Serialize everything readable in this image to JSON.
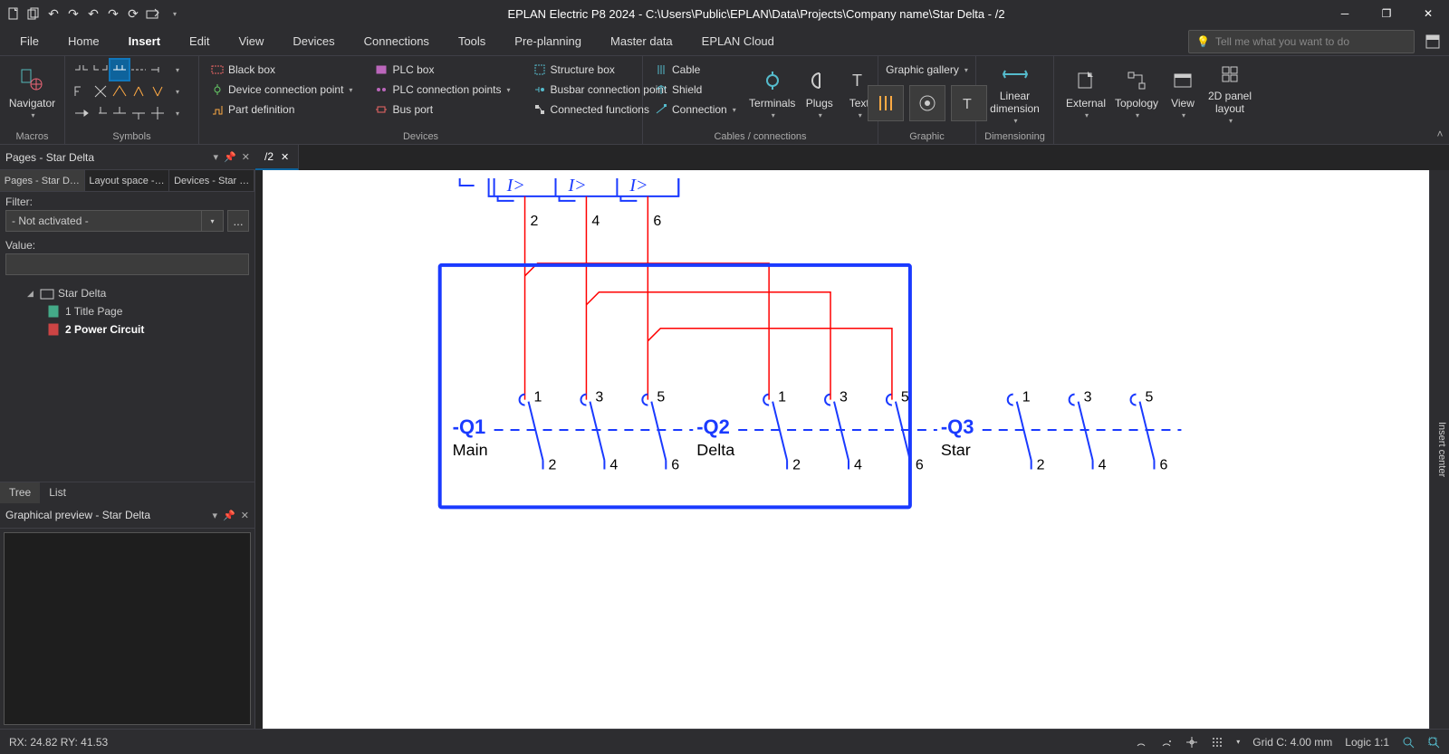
{
  "titlebar": {
    "app_title": "EPLAN Electric P8 2024 - C:\\Users\\Public\\EPLAN\\Data\\Projects\\Company name\\Star Delta - /2"
  },
  "menu": {
    "items": [
      "File",
      "Home",
      "Insert",
      "Edit",
      "View",
      "Devices",
      "Connections",
      "Tools",
      "Pre-planning",
      "Master data",
      "EPLAN Cloud"
    ],
    "active": "Insert",
    "search_placeholder": "Tell me what you want to do"
  },
  "ribbon": {
    "macros": {
      "navigator": "Navigator",
      "label": "Macros"
    },
    "symbols": {
      "label": "Symbols"
    },
    "devices": {
      "label": "Devices",
      "black_box": "Black box",
      "device_conn": "Device connection point",
      "part_def": "Part definition",
      "plc_box": "PLC box",
      "plc_conn": "PLC connection points",
      "bus_port": "Bus port",
      "structure_box": "Structure box",
      "busbar_conn": "Busbar connection point",
      "connected_fn": "Connected functions"
    },
    "cables": {
      "label": "Cables / connections",
      "cable": "Cable",
      "shield": "Shield",
      "connection": "Connection",
      "terminals": "Terminals",
      "plugs": "Plugs",
      "text": "Text"
    },
    "graphic": {
      "label": "Graphic",
      "gallery": "Graphic gallery"
    },
    "dimensioning": {
      "label": "Dimensioning",
      "linear": "Linear dimension"
    },
    "external": "External",
    "topology": "Topology",
    "view": "View",
    "panel2d": "2D panel layout"
  },
  "doc_tabs": {
    "tab1": "/2"
  },
  "left": {
    "header": "Pages - Star Delta",
    "sub1": "Pages - Star D…",
    "sub2": "Layout space -…",
    "sub3": "Devices - Star …",
    "filter_label": "Filter:",
    "filter_value": "- Not activated -",
    "filter_btn": "...",
    "value_label": "Value:",
    "tree_root": "Star Delta",
    "tree_p1": "1 Title Page",
    "tree_p2": "2 Power Circuit",
    "tree_tab_tree": "Tree",
    "tree_tab_list": "List",
    "preview_header": "Graphical preview - Star Delta"
  },
  "right_tab": "Insert center",
  "status": {
    "coords": "RX: 24.82 RY: 41.53",
    "grid": "Grid C: 4.00 mm",
    "logic": "Logic 1:1"
  },
  "schematic": {
    "ol_labels": [
      "I>",
      "I>",
      "I>"
    ],
    "ol_terminals": [
      "2",
      "4",
      "6"
    ],
    "contactors": [
      {
        "tag": "-Q1",
        "name": "Main",
        "top": [
          "1",
          "3",
          "5"
        ],
        "bot": [
          "2",
          "4",
          "6"
        ]
      },
      {
        "tag": "-Q2",
        "name": "Delta",
        "top": [
          "1",
          "3",
          "5"
        ],
        "bot": [
          "2",
          "4",
          "6"
        ]
      },
      {
        "tag": "-Q3",
        "name": "Star",
        "top": [
          "1",
          "3",
          "5"
        ],
        "bot": [
          "2",
          "4",
          "6"
        ]
      }
    ]
  }
}
